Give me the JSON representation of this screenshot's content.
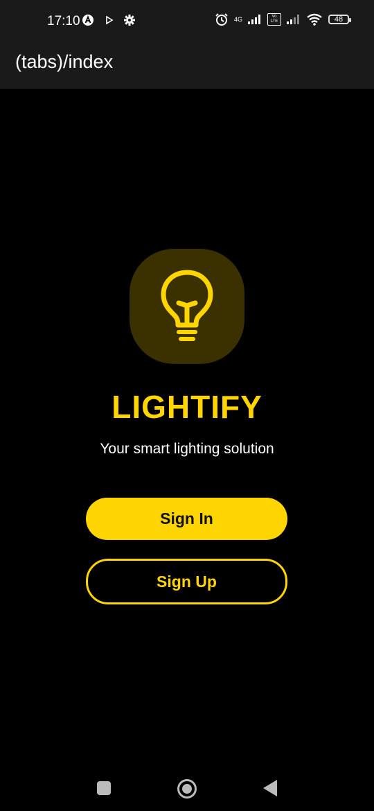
{
  "status_bar": {
    "time": "17:10",
    "network": "4G",
    "volte": "Vo LTE",
    "battery": "48",
    "icons": [
      "a-icon",
      "play-icon",
      "gear-icon",
      "alarm-icon",
      "signal-icon",
      "volte-icon",
      "signal-icon",
      "wifi-icon",
      "battery-icon"
    ]
  },
  "header": {
    "title": "(tabs)/index"
  },
  "main": {
    "logo_icon": "lightbulb-icon",
    "app_name": "LIGHTIFY",
    "tagline": "Your smart lighting solution",
    "sign_in_label": "Sign In",
    "sign_up_label": "Sign Up"
  },
  "colors": {
    "accent": "#ffd500",
    "logo_bg": "#3a3000",
    "background": "#000000",
    "header_bg": "#1a1a1a"
  },
  "nav_bar": {
    "icons": [
      "recent-apps-icon",
      "home-icon",
      "back-icon"
    ]
  }
}
